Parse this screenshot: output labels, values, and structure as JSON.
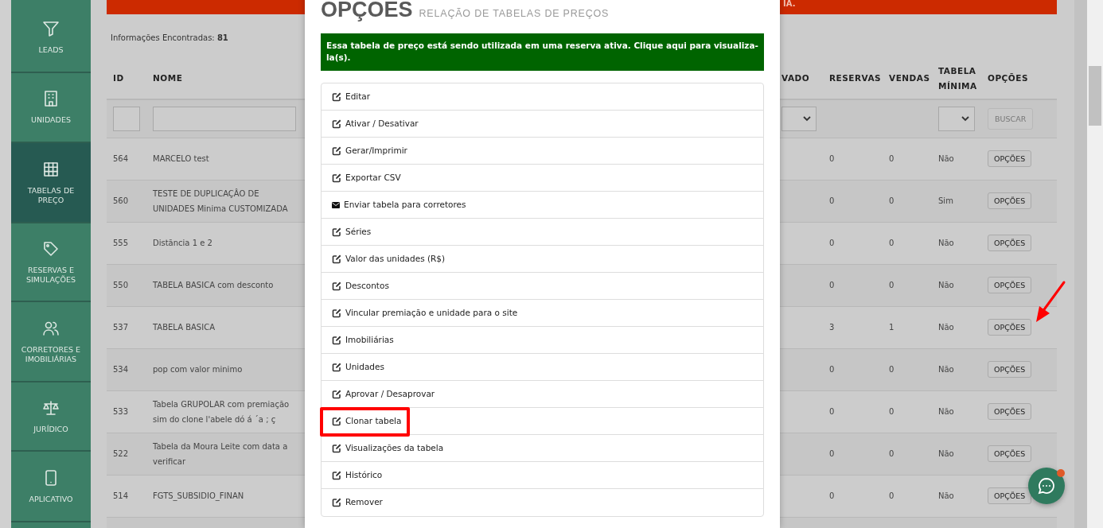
{
  "sidebar": {
    "items": [
      {
        "label": "LEADS",
        "selected": false
      },
      {
        "label": "UNIDADES",
        "selected": false
      },
      {
        "label": "TABELAS DE PREÇO",
        "selected": true
      },
      {
        "label": "RESERVAS E SIMULAÇÕES",
        "selected": false
      },
      {
        "label": "CORRETORES E IMOBILIÁRIAS",
        "selected": false
      },
      {
        "label": "JURÍDICO",
        "selected": false
      },
      {
        "label": "APLICATIVO",
        "selected": false
      }
    ]
  },
  "banner": {
    "text": "IA."
  },
  "info": "Informações Encontradas: **81**",
  "table": {
    "columns": [
      "ID",
      "NOME",
      "VADO",
      "RESERVAS",
      "VENDAS",
      "TABELA MÍNIMA",
      "OPÇÕES"
    ],
    "filter_button": "BUSCAR",
    "rows": [
      {
        "id": "564",
        "nome": "MARCELO test",
        "reservas": "0",
        "vendas": "0",
        "minima": "Não",
        "button": "OPÇÕES"
      },
      {
        "id": "560",
        "nome": "TESTE DE DUPLICAÇÂO DE UNIDADES Minima CUSTOMIZADA",
        "reservas": "0",
        "vendas": "0",
        "minima": "Sim",
        "button": "OPÇÕES"
      },
      {
        "id": "555",
        "nome": "Distãncia 1 e 2",
        "reservas": "0",
        "vendas": "0",
        "minima": "Não",
        "button": "OPÇÕES"
      },
      {
        "id": "550",
        "nome": "TABELA BASICA com desconto",
        "reservas": "0",
        "vendas": "0",
        "minima": "Não",
        "button": "OPÇÕES"
      },
      {
        "id": "537",
        "nome": "TABELA BASICA",
        "reservas": "3",
        "vendas": "1",
        "minima": "Não",
        "button": "OPÇÕES"
      },
      {
        "id": "534",
        "nome": "pop com valor minimo",
        "reservas": "0",
        "vendas": "0",
        "minima": "Não",
        "button": "OPÇÕES"
      },
      {
        "id": "533",
        "nome": "Tabela GRUPOLAR com premiação sim do clone l'abele dó á ´a ; ç",
        "reservas": "0",
        "vendas": "0",
        "minima": "Não",
        "button": "OPÇÕES"
      },
      {
        "id": "522",
        "nome": "Tabela da Moura Leite com data a verificar",
        "reservas": "0",
        "vendas": "0",
        "minima": "Não",
        "button": "OPÇÕES"
      },
      {
        "id": "514",
        "nome": "FGTS_SUBSIDIO_FINAN",
        "reservas": "0",
        "vendas": "0",
        "minima": "Não",
        "button": "OPÇÕES"
      }
    ]
  },
  "modal": {
    "title": "OPÇÕES",
    "subtitle": "RELAÇÃO DE TABELAS DE PREÇOS",
    "alert": "Essa tabela de preço está sendo utilizada em uma reserva ativa. Clique aqui para visualiza-la(s).",
    "items": [
      {
        "label": "Editar",
        "kind": "edit",
        "highlighted": false
      },
      {
        "label": "Ativar / Desativar",
        "kind": "edit",
        "highlighted": false
      },
      {
        "label": "Gerar/Imprimir",
        "kind": "edit",
        "highlighted": false
      },
      {
        "label": "Exportar CSV",
        "kind": "edit",
        "highlighted": false
      },
      {
        "label": "Enviar tabela para corretores",
        "kind": "mail",
        "highlighted": false
      },
      {
        "label": "Séries",
        "kind": "edit",
        "highlighted": false
      },
      {
        "label": "Valor das unidades (R$)",
        "kind": "edit",
        "highlighted": false
      },
      {
        "label": "Descontos",
        "kind": "edit",
        "highlighted": false
      },
      {
        "label": "Vincular premiação e unidade para o site",
        "kind": "edit",
        "highlighted": false
      },
      {
        "label": "Imobiliárias",
        "kind": "edit",
        "highlighted": false
      },
      {
        "label": "Unidades",
        "kind": "edit",
        "highlighted": false
      },
      {
        "label": "Aprovar / Desaprovar",
        "kind": "edit",
        "highlighted": false
      },
      {
        "label": "Clonar tabela",
        "kind": "edit",
        "highlighted": true
      },
      {
        "label": "Visualizações da tabela",
        "kind": "edit",
        "highlighted": false
      },
      {
        "label": "Histórico",
        "kind": "edit",
        "highlighted": false
      },
      {
        "label": "Remover",
        "kind": "edit",
        "highlighted": false
      }
    ]
  }
}
